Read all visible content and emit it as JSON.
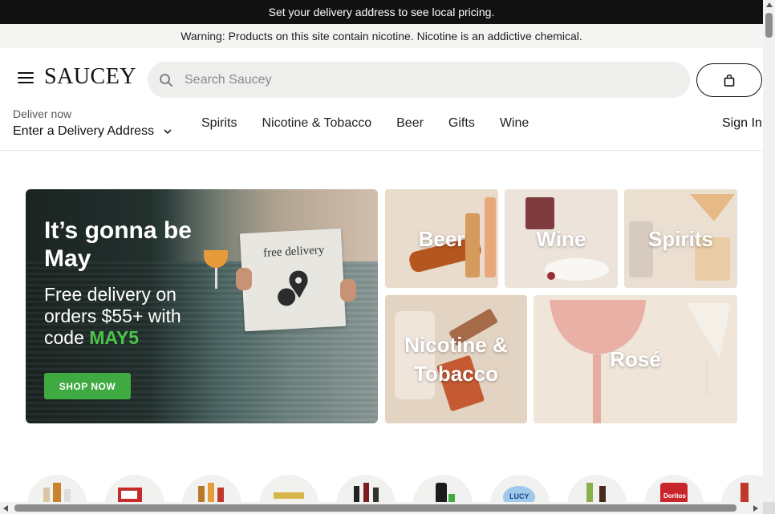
{
  "banners": {
    "delivery_notice": "Set your delivery address to see local pricing.",
    "warning": "Warning: Products on this site contain nicotine. Nicotine is an addictive chemical."
  },
  "header": {
    "logo": "SAUCEY",
    "search_placeholder": "Search Saucey",
    "deliver_label": "Deliver now",
    "deliver_address": "Enter a Delivery Address",
    "nav": [
      "Spirits",
      "Nicotine & Tobacco",
      "Beer",
      "Gifts",
      "Wine"
    ],
    "sign_in": "Sign In"
  },
  "hero": {
    "headline": "It’s gonna be May",
    "body_prefix": "Free delivery on orders $55+ with code ",
    "promo_code": "MAY5",
    "paper_text": "free delivery",
    "cta": "SHOP NOW"
  },
  "categories": [
    {
      "label": "Beer"
    },
    {
      "label": "Wine"
    },
    {
      "label": "Spirits"
    },
    {
      "label": "Nicotine & Tobacco"
    },
    {
      "label": "Rosé"
    }
  ],
  "circle_products": [
    "LUCY",
    "Doritos"
  ],
  "colors": {
    "promo_green": "#4bc44a",
    "cta_green": "#3faa41",
    "topbar": "#111111"
  }
}
